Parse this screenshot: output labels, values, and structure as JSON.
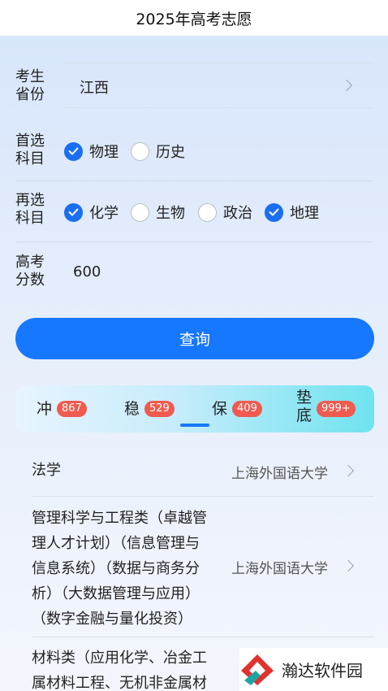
{
  "header": {
    "title": "2025年高考志愿"
  },
  "form": {
    "province": {
      "label": [
        "考生",
        "省份"
      ],
      "value": "江西"
    },
    "primary_subject": {
      "label": [
        "首选",
        "科目"
      ],
      "options": [
        {
          "label": "物理",
          "checked": true
        },
        {
          "label": "历史",
          "checked": false
        }
      ]
    },
    "secondary_subject": {
      "label": [
        "再选",
        "科目"
      ],
      "options": [
        {
          "label": "化学",
          "checked": true
        },
        {
          "label": "生物",
          "checked": false
        },
        {
          "label": "政治",
          "checked": false
        },
        {
          "label": "地理",
          "checked": true
        }
      ]
    },
    "score": {
      "label": [
        "高考",
        "分数"
      ],
      "value": "600"
    }
  },
  "query_button": {
    "label": "查询"
  },
  "tabs": [
    {
      "label": "冲",
      "count": "867"
    },
    {
      "label": "稳",
      "count": "529"
    },
    {
      "label": "保",
      "count": "409"
    },
    {
      "label": [
        "垫",
        "底"
      ],
      "count": "999+"
    }
  ],
  "results": [
    {
      "major_lines": [
        "法学"
      ],
      "school": "上海外国语大学"
    },
    {
      "major_lines": [
        "管理科学与工程类（卓越管",
        "理人才计划）（信息管理与",
        "信息系统）（数据与商务分",
        "析）（大数据管理与应用）",
        "（数字金融与量化投资）"
      ],
      "school": "上海外国语大学"
    },
    {
      "major_lines": [
        "材料类（应用化学、冶金工",
        "属材料工程、无机非金属材"
      ],
      "school": ""
    }
  ],
  "watermark": {
    "text": "瀚达软件园"
  },
  "colors": {
    "primary": "#1677ff",
    "badge": "#f05a4f"
  }
}
